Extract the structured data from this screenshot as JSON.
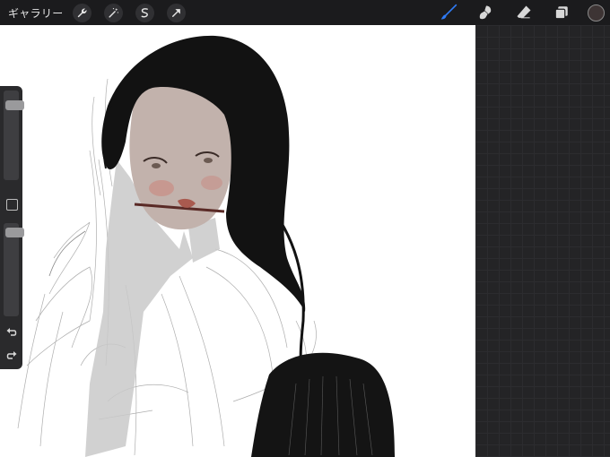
{
  "toolbar": {
    "gallery_label": "ギャラリー",
    "left_tools": [
      "wrench-icon",
      "magic-wand-icon",
      "selection-icon",
      "transform-arrow-icon"
    ],
    "right_tools": [
      "brush-icon",
      "smudge-icon",
      "eraser-icon",
      "layers-icon"
    ],
    "active_tool": "brush-icon",
    "active_color": "#3d3434",
    "accent_color": "#2f7bf6"
  },
  "sidebar": {
    "brush_size": 0.12,
    "brush_opacity": 0.05
  }
}
